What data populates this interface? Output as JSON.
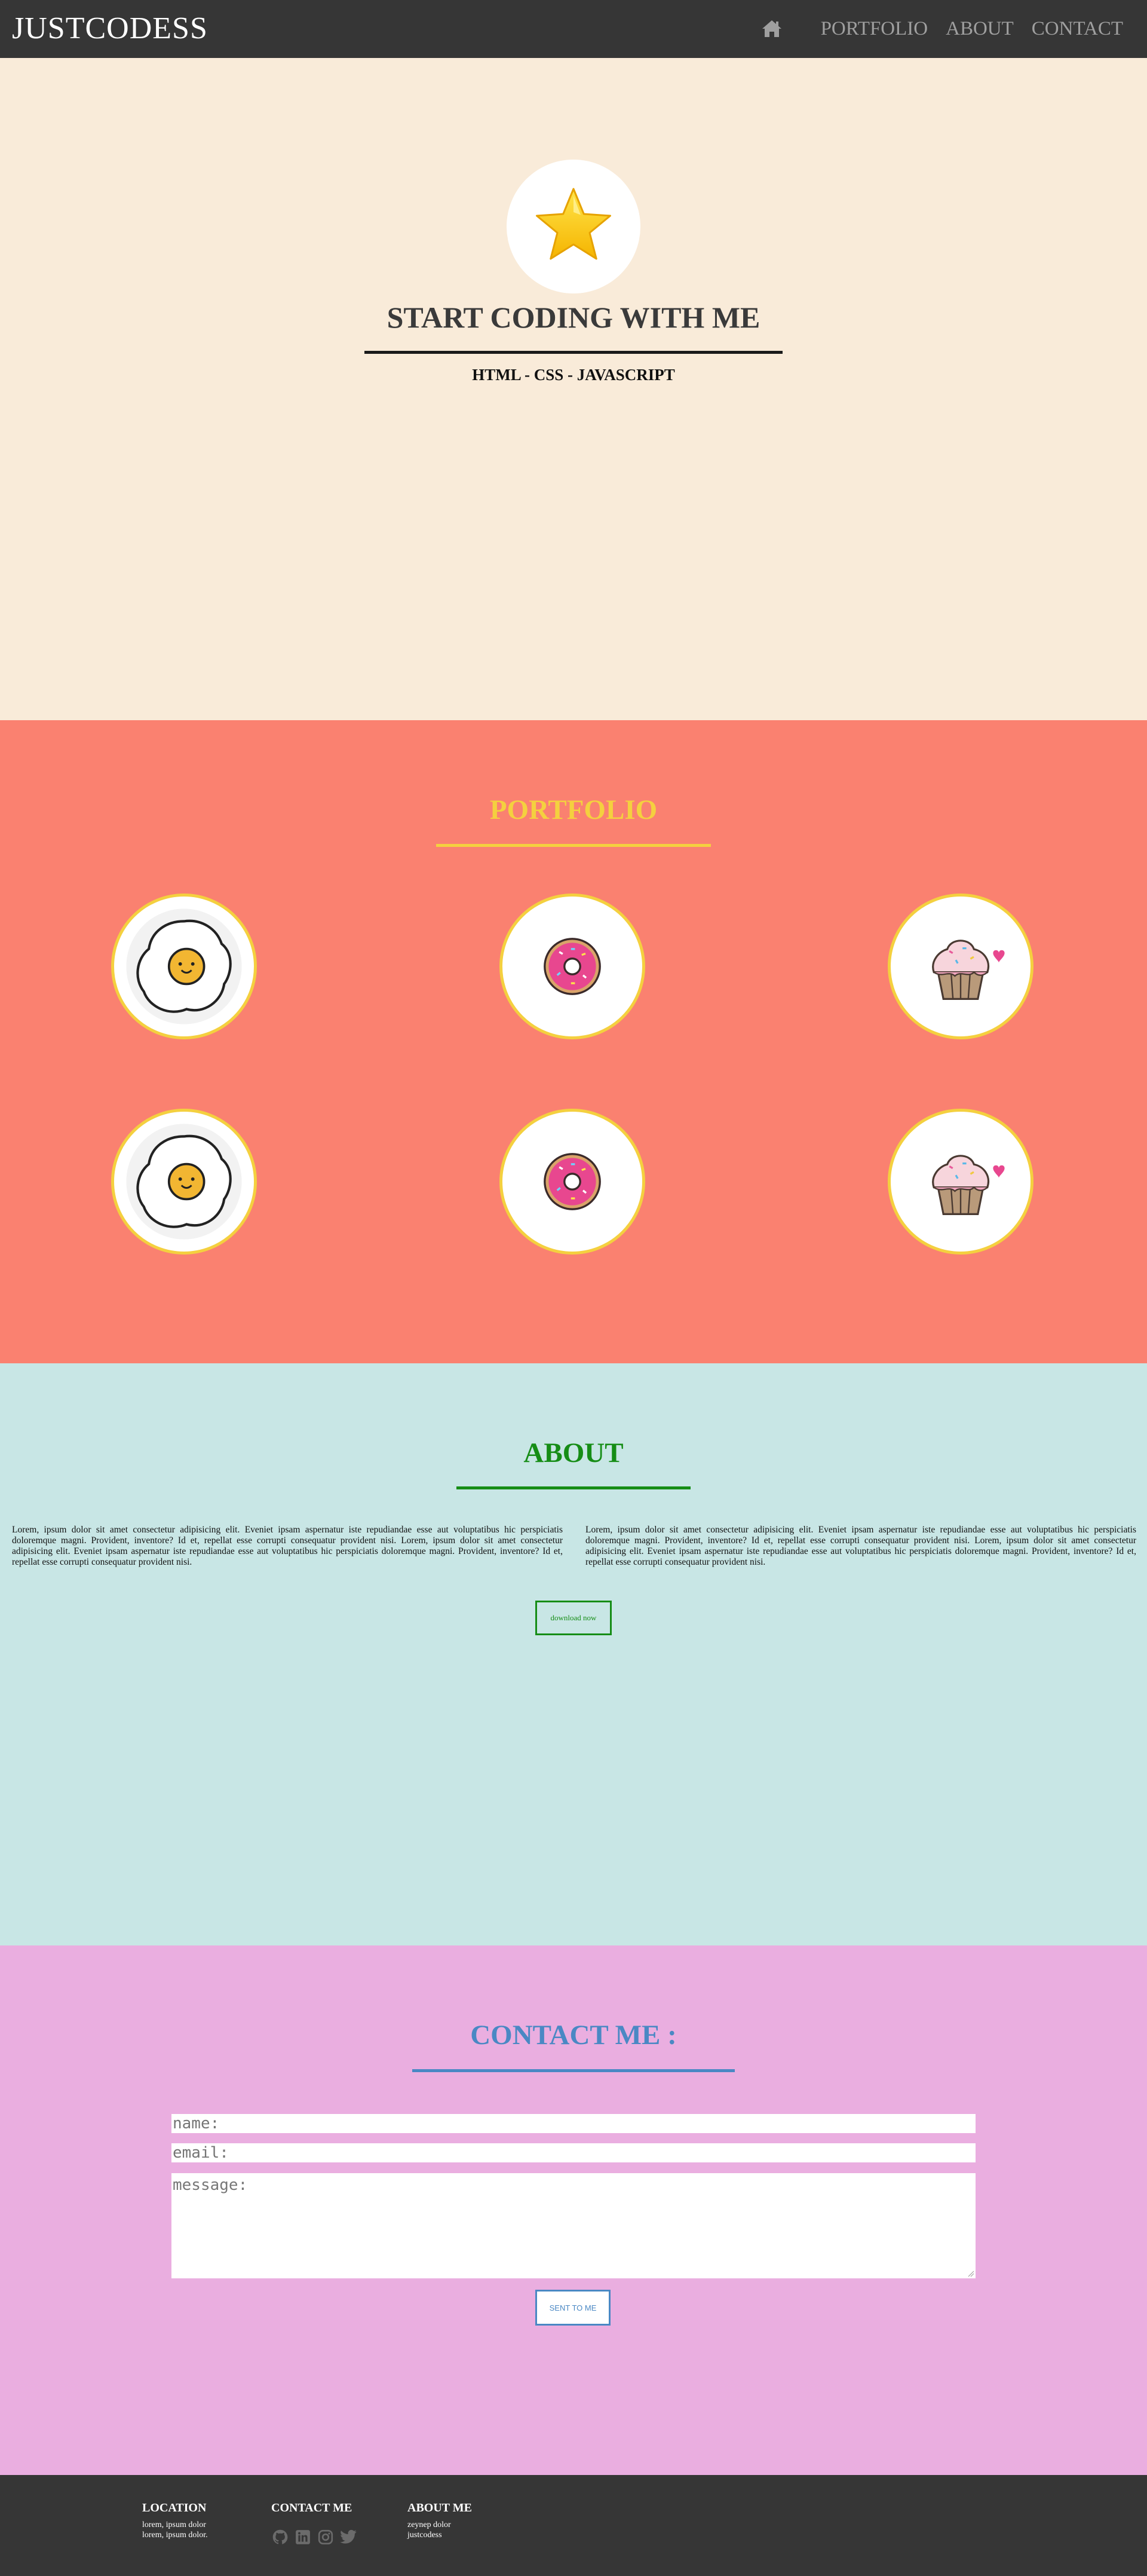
{
  "nav": {
    "brand": "JUSTCODESS",
    "home_icon": "home-icon",
    "links": [
      "PORTFOLIO",
      "ABOUT",
      "CONTACT"
    ]
  },
  "hero": {
    "avatar_icon": "star-icon",
    "title": "START CODING WITH ME",
    "subtitle": "HTML - CSS - JAVASCRIPT"
  },
  "portfolio": {
    "title": "PORTFOLIO",
    "items": [
      {
        "icon": "fried-egg-icon"
      },
      {
        "icon": "donut-icon"
      },
      {
        "icon": "cupcake-icon"
      },
      {
        "icon": "fried-egg-icon"
      },
      {
        "icon": "donut-icon"
      },
      {
        "icon": "cupcake-icon"
      }
    ]
  },
  "about": {
    "title": "ABOUT",
    "paragraph_left": "Lorem, ipsum dolor sit amet consectetur adipisicing elit. Eveniet ipsam aspernatur iste repudiandae esse aut voluptatibus hic perspiciatis doloremque magni. Provident, inventore? Id et, repellat esse corrupti consequatur provident nisi. Lorem, ipsum dolor sit amet consectetur adipisicing elit. Eveniet ipsam aspernatur iste repudiandae esse aut voluptatibus hic perspiciatis doloremque magni. Provident, inventore? Id et, repellat esse corrupti consequatur provident nisi.",
    "paragraph_right": "Lorem, ipsum dolor sit amet consectetur adipisicing elit. Eveniet ipsam aspernatur iste repudiandae esse aut voluptatibus hic perspiciatis doloremque magni. Provident, inventore? Id et, repellat esse corrupti consequatur provident nisi. Lorem, ipsum dolor sit amet consectetur adipisicing elit. Eveniet ipsam aspernatur iste repudiandae esse aut voluptatibus hic perspiciatis doloremque magni. Provident, inventore? Id et, repellat esse corrupti consequatur provident nisi.",
    "button": "download now"
  },
  "contact": {
    "title": "CONTACT ME :",
    "name_placeholder": "name:",
    "email_placeholder": "email:",
    "message_placeholder": "message:",
    "button": "SENT TO ME"
  },
  "footer": {
    "location": {
      "heading": "LOCATION",
      "lines": [
        "lorem, ipsum dolor",
        "lorem, ipsum dolor."
      ]
    },
    "contact": {
      "heading": "CONTACT ME",
      "icons": [
        "github-icon",
        "linkedin-icon",
        "instagram-icon",
        "twitter-icon"
      ]
    },
    "about": {
      "heading": "ABOUT ME",
      "lines": [
        "zeynep dolor",
        "justcodess"
      ]
    }
  },
  "colors": {
    "navbar": "#363636",
    "hero_bg": "#f9ebd9",
    "portfolio_bg": "#fa8170",
    "portfolio_accent": "#f4d03f",
    "about_bg": "#c8e6e5",
    "about_accent": "#168d16",
    "contact_bg": "#eaaee0",
    "contact_accent": "#4a88c4"
  }
}
